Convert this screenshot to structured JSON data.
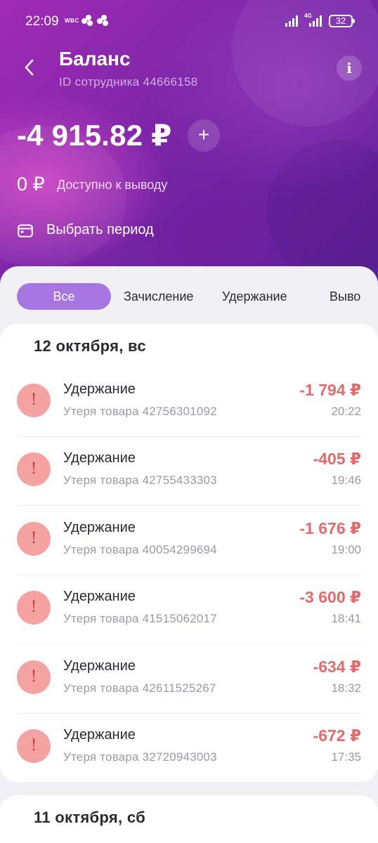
{
  "status": {
    "time": "22:09",
    "network_small": "WBC",
    "net_label": "4G",
    "battery": "32"
  },
  "header": {
    "title": "Баланс",
    "employee_id": "ID сотрудника 44666158",
    "info_label": "i"
  },
  "balance": {
    "amount": "-4 915.82 ₽",
    "add_label": "+",
    "available_amount": "0 ₽",
    "available_label": "Доступно к выводу",
    "period_label": "Выбрать период"
  },
  "tabs": [
    {
      "label": "Все",
      "active": true
    },
    {
      "label": "Зачисление",
      "active": false
    },
    {
      "label": "Удержание",
      "active": false
    },
    {
      "label": "Выво",
      "active": false
    }
  ],
  "groups": [
    {
      "date": "12 октября, вс",
      "items": [
        {
          "title": "Удержание",
          "desc": "Утеря товара 42756301092",
          "amount": "-1 794 ₽",
          "time": "20:22",
          "icon": "!"
        },
        {
          "title": "Удержание",
          "desc": "Утеря товара 42755433303",
          "amount": "-405 ₽",
          "time": "19:46",
          "icon": "!"
        },
        {
          "title": "Удержание",
          "desc": "Утеря товара 40054299694",
          "amount": "-1 676 ₽",
          "time": "19:00",
          "icon": "!"
        },
        {
          "title": "Удержание",
          "desc": "Утеря товара 41515062017",
          "amount": "-3 600 ₽",
          "time": "18:41",
          "icon": "!"
        },
        {
          "title": "Удержание",
          "desc": "Утеря товара 42611525267",
          "amount": "-634 ₽",
          "time": "18:32",
          "icon": "!"
        },
        {
          "title": "Удержание",
          "desc": "Утеря товара 32720943003",
          "amount": "-672 ₽",
          "time": "17:35",
          "icon": "!"
        }
      ]
    },
    {
      "date": "11 октября, сб",
      "items": []
    }
  ],
  "colors": {
    "accent": "#a876e2",
    "negative": "#e36a6a",
    "warning_icon_bg": "#f5a2a2",
    "hero_purple": "#7a25a8"
  },
  "icons": {
    "back": "chevron-left-icon",
    "info": "info-icon",
    "add": "plus-icon",
    "calendar": "calendar-icon",
    "warning": "exclamation-icon"
  }
}
